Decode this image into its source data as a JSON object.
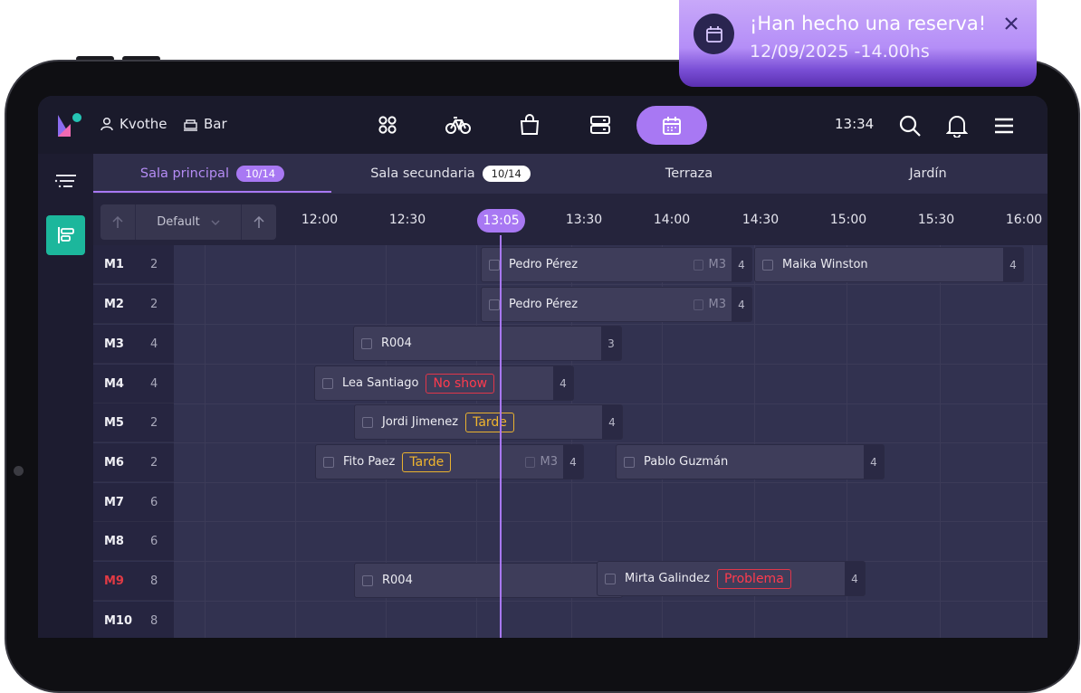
{
  "header": {
    "user_name": "Kvothe",
    "venue_name": "Bar",
    "clock": "13:34",
    "nav_icons": [
      "grid-icon",
      "bike-icon",
      "shopping-bag-icon",
      "server-icon",
      "calendar-icon"
    ]
  },
  "tabs": [
    {
      "label": "Sala principal",
      "badge": "10/14"
    },
    {
      "label": "Sala secundaria",
      "badge": "10/14"
    },
    {
      "label": "Terraza",
      "badge": ""
    },
    {
      "label": "Jardín",
      "badge": ""
    }
  ],
  "sorter": {
    "label": "Default"
  },
  "timeline": {
    "current_time": "13:05",
    "times": [
      "12:00",
      "12:30",
      "13:30",
      "14:00",
      "14:30",
      "15:00",
      "15:30",
      "16:00"
    ]
  },
  "rows": [
    {
      "name": "M1",
      "capacity": "2"
    },
    {
      "name": "M2",
      "capacity": "2"
    },
    {
      "name": "M3",
      "capacity": "4"
    },
    {
      "name": "M4",
      "capacity": "4"
    },
    {
      "name": "M5",
      "capacity": "2"
    },
    {
      "name": "M6",
      "capacity": "2"
    },
    {
      "name": "M7",
      "capacity": "6"
    },
    {
      "name": "M8",
      "capacity": "6"
    },
    {
      "name": "M9",
      "capacity": "8"
    },
    {
      "name": "M10",
      "capacity": "8"
    }
  ],
  "reservations": [
    {
      "name": "Pedro Pérez",
      "table": "M3",
      "pax": "4"
    },
    {
      "name": "Maika Winston",
      "pax": "4"
    },
    {
      "name": "Pedro Pérez",
      "table": "M3",
      "pax": "4"
    },
    {
      "name": "R004",
      "pax": "3"
    },
    {
      "name": "Lea Santiago",
      "status": "No show",
      "pax": "4"
    },
    {
      "name": "Jordi Jimenez",
      "status": "Tarde",
      "pax": "4"
    },
    {
      "name": "Fito Paez",
      "status": "Tarde",
      "table": "M3",
      "pax": "4"
    },
    {
      "name": "Pablo Guzmán",
      "pax": "4"
    },
    {
      "name": "R004"
    },
    {
      "name": "Mirta Galindez",
      "status": "Problema",
      "pax": "4"
    }
  ],
  "notification": {
    "title": "¡Han hecho una reserva!",
    "subtitle": "12/09/2025 -14.00hs"
  },
  "colors": {
    "accent": "#a878f3",
    "teal": "#1cb79c",
    "danger": "#e0364a",
    "warning": "#e9b22f"
  }
}
